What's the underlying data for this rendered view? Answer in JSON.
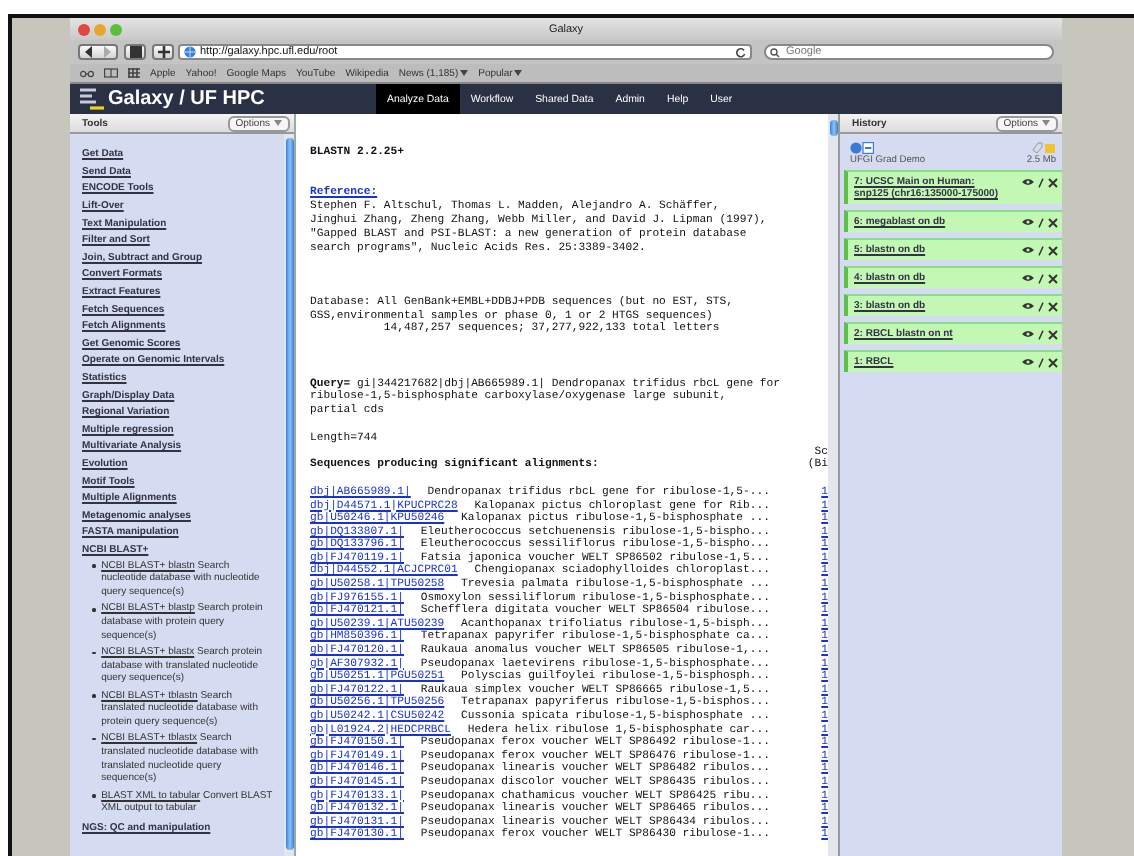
{
  "browser": {
    "title": "Galaxy",
    "url": "http://galaxy.hpc.ufl.edu/root",
    "search": {
      "placeholder": "Google"
    },
    "bookmarks": [
      {
        "label": "Apple",
        "menu": false
      },
      {
        "label": "Yahoo!",
        "menu": false
      },
      {
        "label": "Google Maps",
        "menu": false
      },
      {
        "label": "YouTube",
        "menu": false
      },
      {
        "label": "Wikipedia",
        "menu": false
      },
      {
        "label": "News (1,185)",
        "menu": true
      },
      {
        "label": "Popular",
        "menu": true
      }
    ]
  },
  "masthead": {
    "brand": "Galaxy / UF HPC",
    "tabs": [
      {
        "label": "Analyze Data",
        "selected": true
      },
      {
        "label": "Workflow",
        "selected": false
      },
      {
        "label": "Shared Data",
        "selected": false
      },
      {
        "label": "Admin",
        "selected": false
      },
      {
        "label": "Help",
        "selected": false
      },
      {
        "label": "User",
        "selected": false
      }
    ]
  },
  "tools": {
    "title": "Tools",
    "options": "Options",
    "items": [
      {
        "kind": "section",
        "name": "Get Data"
      },
      {
        "kind": "section",
        "name": "Send Data"
      },
      {
        "kind": "section",
        "name": "ENCODE Tools"
      },
      {
        "kind": "section",
        "name": "Lift-Over"
      },
      {
        "kind": "section",
        "name": "Text Manipulation"
      },
      {
        "kind": "section",
        "name": "Filter and Sort"
      },
      {
        "kind": "section",
        "name": "Join, Subtract and Group"
      },
      {
        "kind": "section",
        "name": "Convert Formats"
      },
      {
        "kind": "section",
        "name": "Extract Features"
      },
      {
        "kind": "section",
        "name": "Fetch Sequences"
      },
      {
        "kind": "section",
        "name": "Fetch Alignments"
      },
      {
        "kind": "section",
        "name": "Get Genomic Scores"
      },
      {
        "kind": "section",
        "name": "Operate on Genomic Intervals"
      },
      {
        "kind": "section",
        "name": "Statistics"
      },
      {
        "kind": "section",
        "name": "Graph/Display Data"
      },
      {
        "kind": "section",
        "name": "Regional Variation"
      },
      {
        "kind": "section",
        "name": "Multiple regression"
      },
      {
        "kind": "section",
        "name": "Multivariate Analysis"
      },
      {
        "kind": "section",
        "name": "Evolution"
      },
      {
        "kind": "section",
        "name": "Motif Tools"
      },
      {
        "kind": "section",
        "name": "Multiple Alignments"
      },
      {
        "kind": "section",
        "name": "Metagenomic analyses"
      },
      {
        "kind": "section",
        "name": "FASTA manipulation"
      },
      {
        "kind": "section",
        "name": "NCBI BLAST+"
      },
      {
        "kind": "tool",
        "name": "NCBI BLAST+ blastn",
        "description": "Search nucleotide database with nucleotide query sequence(s)"
      },
      {
        "kind": "tool",
        "name": "NCBI BLAST+ blastp",
        "description": "Search protein database with protein query sequence(s)"
      },
      {
        "kind": "tool",
        "name": "NCBI BLAST+ blastx",
        "description": "Search protein database with translated nucleotide query sequence(s)"
      },
      {
        "kind": "tool",
        "name": "NCBI BLAST+ tblastn",
        "description": "Search translated nucleotide database with protein query sequence(s)"
      },
      {
        "kind": "tool",
        "name": "NCBI BLAST+ tblastx",
        "description": "Search translated nucleotide database with translated nucleotide query sequence(s)"
      },
      {
        "kind": "tool",
        "name": "BLAST XML to tabular",
        "description": "Convert BLAST XML output to tabular"
      },
      {
        "kind": "section",
        "name": "NGS: QC and manipulation"
      }
    ]
  },
  "result": {
    "program": "BLASTN 2.2.25+",
    "reference_label": "Reference:",
    "reference_text": "Stephen F. Altschul, Thomas L. Madden, Alejandro A. Schäffer,\nJinghui Zhang, Zheng Zhang, Webb Miller, and David J. Lipman (1997),\n\"Gapped BLAST and PSI-BLAST: a new generation of protein database\nsearch programs\", Nucleic Acids Res. 25:3389-3402.",
    "database": "Database: All GenBank+EMBL+DDBJ+PDB sequences (but no EST, STS,\nGSS,environmental samples or phase 0, 1 or 2 HTGS sequences)\n           14,487,257 sequences; 37,277,922,133 total letters",
    "query": "**Query=** gi|344217682|dbj|AB665989.1| Dendropanax trifidus rbcL gene for\nribulose-1,5-bisphosphate carboxylase/oxygenase large subunit,\npartial cds",
    "length": "Length=744",
    "heading": "Sequences producing significant alignments:",
    "score_heading": [
      "Sc",
      "(Bi"
    ],
    "hits": [
      {
        "accession": "dbj|AB665989.1|",
        "description": "Dendropanax trifidus rbcL gene for ribulose-1,5-...",
        "score": "1"
      },
      {
        "accession": "dbj|D44571.1|KPUCPRC28",
        "description": "Kalopanax pictus chloroplast gene for Rib...",
        "score": "1"
      },
      {
        "accession": "gb|U50246.1|KPU50246",
        "description": "Kalopanax pictus ribulose-1,5-bisphosphate ...",
        "score": "1"
      },
      {
        "accession": "gb|DQ133807.1|",
        "description": "Eleutherococcus setchuenensis ribulose-1,5-bispho...",
        "score": "1"
      },
      {
        "accession": "gb|DQ133796.1|",
        "description": "Eleutherococcus sessiliflorus ribulose-1,5-bispho...",
        "score": "1"
      },
      {
        "accession": "gb|FJ470119.1|",
        "description": "Fatsia japonica voucher WELT SP86502 ribulose-1,5...",
        "score": "1"
      },
      {
        "accession": "dbj|D44552.1|ACJCPRC01",
        "description": "Chengiopanax sciadophylloides chloroplast...",
        "score": "1"
      },
      {
        "accession": "gb|U50258.1|TPU50258",
        "description": "Trevesia palmata ribulose-1,5-bisphosphate ...",
        "score": "1"
      },
      {
        "accession": "gb|FJ976155.1|",
        "description": "Osmoxylon sessiliflorum ribulose-1,5-bisphosphate...",
        "score": "1"
      },
      {
        "accession": "gb|FJ470121.1|",
        "description": "Schefflera digitata voucher WELT SP86504 ribulose...",
        "score": "1"
      },
      {
        "accession": "gb|U50239.1|ATU50239",
        "description": "Acanthopanax trifoliatus ribulose-1,5-bisph...",
        "score": "1"
      },
      {
        "accession": "gb|HM850396.1|",
        "description": "Tetrapanax papyrifer ribulose-1,5-bisphosphate ca...",
        "score": "1"
      },
      {
        "accession": "gb|FJ470120.1|",
        "description": "Raukaua anomalus voucher WELT SP86505 ribulose-1,...",
        "score": "1"
      },
      {
        "accession": "gb|AF307932.1|",
        "description": "Pseudopanax laetevirens ribulose-1,5-bisphosphate...",
        "score": "1"
      },
      {
        "accession": "gb|U50251.1|PGU50251",
        "description": "Polyscias guilfoylei ribulose-1,5-bisphosph...",
        "score": "1"
      },
      {
        "accession": "gb|FJ470122.1|",
        "description": "Raukaua simplex voucher WELT SP86665 ribulose-1,5...",
        "score": "1"
      },
      {
        "accession": "gb|U50256.1|TPU50256",
        "description": "Tetrapanax papyriferus ribulose-1,5-bisphos...",
        "score": "1"
      },
      {
        "accession": "gb|U50242.1|CSU50242",
        "description": "Cussonia spicata ribulose-1,5-bisphosphate ...",
        "score": "1"
      },
      {
        "accession": "gb|L01924.2|HEDCPRBCL",
        "description": "Hedera helix ribulose 1,5-bisphosphate car...",
        "score": "1"
      },
      {
        "accession": "gb|FJ470150.1|",
        "description": "Pseudopanax ferox voucher WELT SP86492 ribulose-1...",
        "score": "1"
      },
      {
        "accession": "gb|FJ470149.1|",
        "description": "Pseudopanax ferox voucher WELT SP86476 ribulose-1...",
        "score": "1"
      },
      {
        "accession": "gb|FJ470146.1|",
        "description": "Pseudopanax linearis voucher WELT SP86482 ribulos...",
        "score": "1"
      },
      {
        "accession": "gb|FJ470145.1|",
        "description": "Pseudopanax discolor voucher WELT SP86435 ribulos...",
        "score": "1"
      },
      {
        "accession": "gb|FJ470133.1|",
        "description": "Pseudopanax chathamicus voucher WELT SP86425 ribu...",
        "score": "1"
      },
      {
        "accession": "gb|FJ470132.1|",
        "description": "Pseudopanax linearis voucher WELT SP86465 ribulos...",
        "score": "1"
      },
      {
        "accession": "gb|FJ470131.1|",
        "description": "Pseudopanax linearis voucher WELT SP86434 ribulos...",
        "score": "1"
      },
      {
        "accession": "gb|FJ470130.1|",
        "description": "Pseudopanax ferox voucher WELT SP86430 ribulose-1...",
        "score": "1"
      }
    ]
  },
  "history": {
    "title": "History",
    "options": "Options",
    "name": "UFGI Grad Demo",
    "size": "2.5 Mb",
    "datasets": [
      {
        "name": "7: UCSC Main on Human: snp125 (chr16:135000-175000)"
      },
      {
        "name": "6: megablast on db"
      },
      {
        "name": "5: blastn on db"
      },
      {
        "name": "4: blastn on db"
      },
      {
        "name": "3: blastn on db"
      },
      {
        "name": "2: RBCL blastn on nt"
      },
      {
        "name": "1: RBCL"
      }
    ]
  }
}
